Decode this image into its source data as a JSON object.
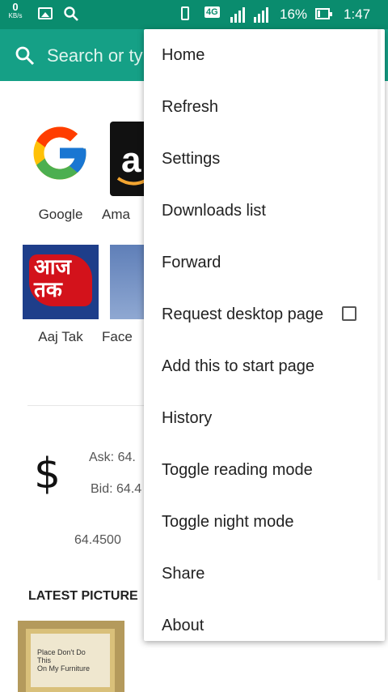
{
  "status_bar": {
    "speed": "0",
    "speed_unit": "KB/s",
    "network": "4G",
    "battery": "16%",
    "time": "1:47",
    "icons": [
      "image-icon",
      "search-icon",
      "vibrate-icon",
      "signal-icon",
      "battery-icon"
    ]
  },
  "toolbar": {
    "search_placeholder": "Search or ty"
  },
  "speed_dial": [
    {
      "label": "Google"
    },
    {
      "label": "Ama"
    },
    {
      "label": "Aaj Tak"
    },
    {
      "label": "Face"
    }
  ],
  "currency": {
    "symbol": "$",
    "ask": "Ask: 64.",
    "bid": "Bid: 64.4",
    "rate": "64.4500"
  },
  "latest_pictures": {
    "heading": "LATEST PICTURE"
  },
  "menu": {
    "items": [
      "Home",
      "Refresh",
      "Settings",
      "Downloads list",
      "Forward",
      "Request desktop page",
      "Add this to start page",
      "History",
      "Toggle reading mode",
      "Toggle night mode",
      "Share",
      "About"
    ],
    "request_desktop_checked": false
  },
  "colors": {
    "status_bar": "#0a8c6e",
    "toolbar": "#15a086"
  }
}
